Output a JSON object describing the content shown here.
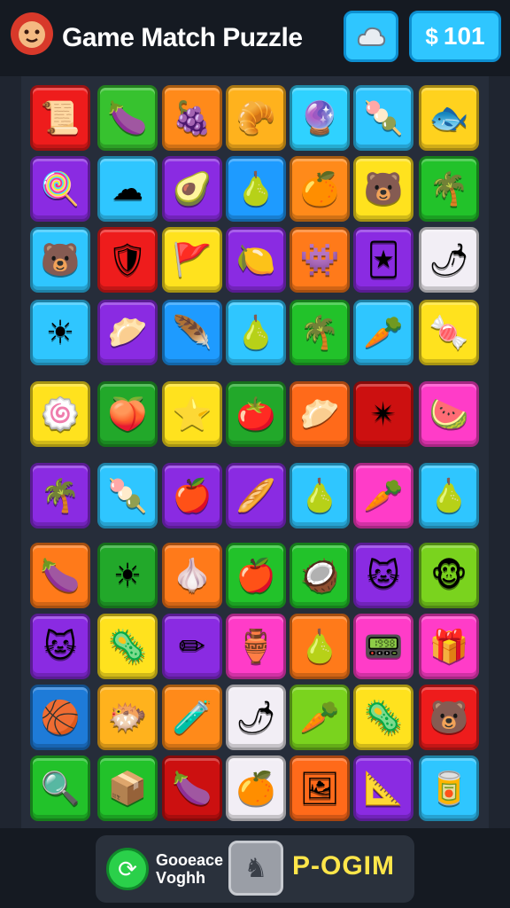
{
  "header": {
    "title": "Game Match Puzzle",
    "logo_icon": "lion-face-icon",
    "hint_icon": "cloud-icon",
    "coins": "101",
    "coin_symbol": "$"
  },
  "colors": {
    "header_bg": "#151a22",
    "board_bg": "#262d3a",
    "accent": "#2fc6ff",
    "footer_label": "#ffe64a"
  },
  "board": {
    "rows": 10,
    "cols": 7,
    "tiles": [
      [
        {
          "c": "#ee1c1c",
          "g": "📜",
          "n": "scroll"
        },
        {
          "c": "#37c22f",
          "g": "🍆",
          "n": "leaf"
        },
        {
          "c": "#ff8a1a",
          "g": "🍇",
          "n": "plum"
        },
        {
          "c": "#ffb21d",
          "g": "🥐",
          "n": "bread"
        },
        {
          "c": "#2fd2ff",
          "g": "🔮",
          "n": "orb"
        },
        {
          "c": "#2fc6ff",
          "g": "🍡",
          "n": "skewer"
        },
        {
          "c": "#ffd21e",
          "g": "🐟",
          "n": "fish"
        }
      ],
      [
        {
          "c": "#8a2be2",
          "g": "🍭",
          "n": "candy"
        },
        {
          "c": "#2fc6ff",
          "g": "☁",
          "n": "cloud"
        },
        {
          "c": "#8a2be2",
          "g": "🥑",
          "n": "avocado"
        },
        {
          "c": "#1e9bff",
          "g": "🍐",
          "n": "pear"
        },
        {
          "c": "#ff8a1a",
          "g": "🍊",
          "n": "orange"
        },
        {
          "c": "#ffe21e",
          "g": "🐻",
          "n": "bear"
        },
        {
          "c": "#22c22a",
          "g": "🌴",
          "n": "palm"
        }
      ],
      [
        {
          "c": "#2fc6ff",
          "g": "🐻",
          "n": "bear"
        },
        {
          "c": "#ee1c1c",
          "g": "🛡",
          "n": "shield"
        },
        {
          "c": "#ffe21e",
          "g": "🚩",
          "n": "flag"
        },
        {
          "c": "#8a2be2",
          "g": "🍋",
          "n": "lemon"
        },
        {
          "c": "#ff7a1a",
          "g": "👾",
          "n": "monster"
        },
        {
          "c": "#8a2be2",
          "g": "🃏",
          "n": "card"
        },
        {
          "c": "#f2eef5",
          "g": "🌶",
          "n": "pepper"
        }
      ],
      [
        {
          "c": "#2fc6ff",
          "g": "☀",
          "n": "sun"
        },
        {
          "c": "#8a2be2",
          "g": "🥟",
          "n": "dumpling"
        },
        {
          "c": "#1e9bff",
          "g": "🪶",
          "n": "feather"
        },
        {
          "c": "#2fc6ff",
          "g": "🍐",
          "n": "pear"
        },
        {
          "c": "#22c22a",
          "g": "🌴",
          "n": "palm"
        },
        {
          "c": "#2fc6ff",
          "g": "🥕",
          "n": "carrot"
        },
        {
          "c": "#ffe21e",
          "g": "🍬",
          "n": "candy"
        }
      ],
      [
        {
          "c": "#ffe21e",
          "g": "🍥",
          "n": "swirl"
        },
        {
          "c": "#22a82a",
          "g": "🍑",
          "n": "peach"
        },
        {
          "c": "#ffe21e",
          "g": "⭐",
          "n": "star"
        },
        {
          "c": "#22a82a",
          "g": "🍅",
          "n": "tomato"
        },
        {
          "c": "#ff6a1a",
          "g": "🥟",
          "n": "dumpling"
        },
        {
          "c": "#cc1010",
          "g": "✴",
          "n": "star-burst"
        },
        {
          "c": "#ff3cc8",
          "g": "🍉",
          "n": "melon"
        }
      ],
      [
        {
          "c": "#8a2be2",
          "g": "🌴",
          "n": "palm"
        },
        {
          "c": "#2fc6ff",
          "g": "🍡",
          "n": "lollipop"
        },
        {
          "c": "#8a2be2",
          "g": "🍎",
          "n": "apple"
        },
        {
          "c": "#8a2be2",
          "g": "🥖",
          "n": "baguette"
        },
        {
          "c": "#2fc6ff",
          "g": "🍐",
          "n": "pear"
        },
        {
          "c": "#ff3cc8",
          "g": "🥕",
          "n": "carrot"
        },
        {
          "c": "#2fc6ff",
          "g": "🍐",
          "n": "pear"
        }
      ],
      [
        {
          "c": "#ff7a1a",
          "g": "🍆",
          "n": "eggplant"
        },
        {
          "c": "#22a82a",
          "g": "☀",
          "n": "sun"
        },
        {
          "c": "#ff7a1a",
          "g": "🧄",
          "n": "garlic"
        },
        {
          "c": "#22c22a",
          "g": "🍎",
          "n": "apple"
        },
        {
          "c": "#22c22a",
          "g": "🥥",
          "n": "coconut"
        },
        {
          "c": "#8a2be2",
          "g": "🐱",
          "n": "cat"
        },
        {
          "c": "#7ad31e",
          "g": "🐵",
          "n": "monkey"
        }
      ],
      [
        {
          "c": "#8a2be2",
          "g": "🐱",
          "n": "cat"
        },
        {
          "c": "#ffe21e",
          "g": "🦠",
          "n": "germ"
        },
        {
          "c": "#8a2be2",
          "g": "✏",
          "n": "pencil"
        },
        {
          "c": "#ff3cc8",
          "g": "🏺",
          "n": "vase"
        },
        {
          "c": "#ff7a1a",
          "g": "🍐",
          "n": "pear"
        },
        {
          "c": "#ff3cc8",
          "g": "📟",
          "n": "device"
        },
        {
          "c": "#ff3cc8",
          "g": "🎁",
          "n": "gift"
        }
      ],
      [
        {
          "c": "#1e7bd8",
          "g": "🏀",
          "n": "ball"
        },
        {
          "c": "#ffb21d",
          "g": "🐡",
          "n": "fish"
        },
        {
          "c": "#ff8a1a",
          "g": "🧪",
          "n": "bottle"
        },
        {
          "c": "#f2eef5",
          "g": "🌶",
          "n": "pepper"
        },
        {
          "c": "#7ad31e",
          "g": "🥕",
          "n": "carrot"
        },
        {
          "c": "#ffe21e",
          "g": "🦠",
          "n": "germ"
        },
        {
          "c": "#ee1c1c",
          "g": "🐻",
          "n": "bear"
        }
      ],
      [
        {
          "c": "#22c22a",
          "g": "🔍",
          "n": "magnifier"
        },
        {
          "c": "#22c22a",
          "g": "📦",
          "n": "box"
        },
        {
          "c": "#cc1010",
          "g": "🍆",
          "n": "eggplant"
        },
        {
          "c": "#f2eef5",
          "g": "🍊",
          "n": "orange"
        },
        {
          "c": "#ff6a1a",
          "g": "🖼",
          "n": "picture"
        },
        {
          "c": "#8a2be2",
          "g": "📐",
          "n": "ruler"
        },
        {
          "c": "#2fc6ff",
          "g": "🥫",
          "n": "jar"
        }
      ]
    ]
  },
  "footer": {
    "left_icon": "refresh-icon",
    "left_text_line1": "Goоeace",
    "left_text_line2": "Vоghh",
    "middle_icon": "lion-silhouette-icon",
    "label": "P-OGIM"
  }
}
